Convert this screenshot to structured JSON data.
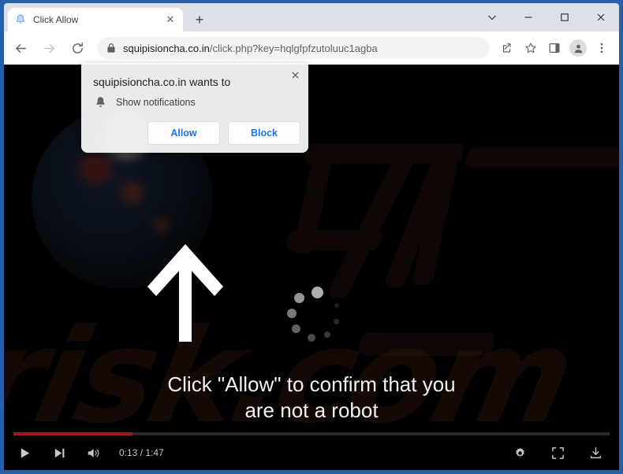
{
  "window": {
    "border_color": "#2560a8",
    "controls": [
      {
        "name": "tab-search-button",
        "glyph": "chevron-down-icon"
      },
      {
        "name": "minimize-button",
        "glyph": "minimize-icon"
      },
      {
        "name": "maximize-button",
        "glyph": "maximize-icon"
      },
      {
        "name": "close-button",
        "glyph": "close-icon"
      }
    ]
  },
  "tab": {
    "title": "Click Allow",
    "favicon": "bell-favicon",
    "close_label": "✕",
    "new_tab_label": "+"
  },
  "toolbar": {
    "back_label": "←",
    "forward_label": "→",
    "reload_label": "⟳",
    "url_full": "squipisioncha.co.in/click.php?key=hqlgfpfzutoluuc1agba",
    "url_host": "squipisioncha.co.in",
    "url_path": "/click.php?key=hqlgfpfzutoluuc1agba",
    "lock_icon": "lock-icon",
    "icons": [
      {
        "name": "share-icon"
      },
      {
        "name": "bookmark-star-icon"
      },
      {
        "name": "side-panel-icon"
      },
      {
        "name": "profile-avatar-icon"
      },
      {
        "name": "three-dot-menu-icon"
      }
    ]
  },
  "permission_dialog": {
    "title": "squipisioncha.co.in wants to",
    "permission_label": "Show notifications",
    "permission_icon": "bell-icon",
    "close_label": "✕",
    "allow_label": "Allow",
    "block_label": "Block",
    "accent_color": "#1a73e8"
  },
  "page": {
    "headline_line1": "Click \"Allow\" to confirm that you",
    "headline_line2": "are not a robot",
    "arrow_icon": "up-arrow-icon",
    "spinner_icon": "loading-spinner-icon",
    "watermark_text": "risk.com",
    "background_color": "#000000"
  },
  "player": {
    "play_label": "play-icon",
    "next_label": "next-track-icon",
    "volume_label": "volume-icon",
    "time_display": "0:13 / 1:47",
    "current_time": "0:13",
    "duration": "1:47",
    "progress_percent": 20,
    "progress_color": "#9e1b1b",
    "settings_label": "gear-icon",
    "fullscreen_label": "fullscreen-icon",
    "download_label": "download-icon"
  }
}
